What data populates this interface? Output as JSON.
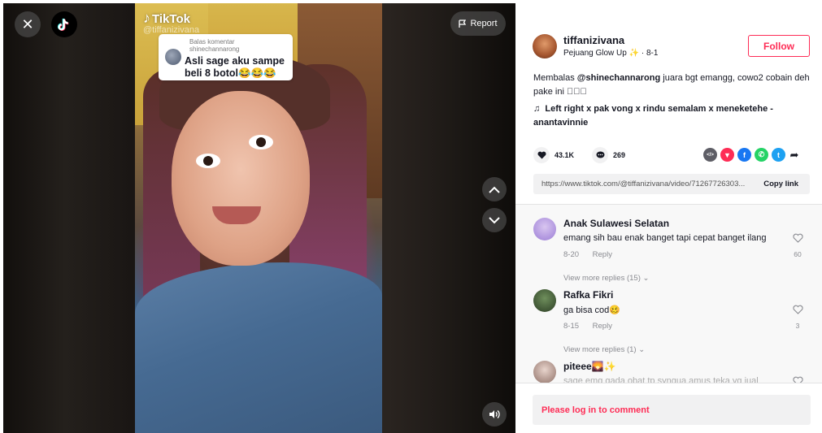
{
  "video": {
    "watermark": "TikTok",
    "watermark_handle": "@tiffanizivana",
    "report_label": "Report",
    "reply_bubble": {
      "label": "Balas komentar shinechannarong",
      "text": "Asli sage aku sampe beli 8 botol😂😂😂"
    },
    "icons": {
      "close": "close-icon",
      "logo": "tiktok-logo",
      "report": "flag-icon",
      "prev": "chevron-up-icon",
      "next": "chevron-down-icon",
      "sound": "speaker-icon"
    }
  },
  "author": {
    "username": "tiffanizivana",
    "subtitle_prefix": "Pejuang Glow Up",
    "subtitle_sparkle": "✨",
    "subtitle_date": "· 8-1",
    "follow_label": "Follow"
  },
  "post": {
    "desc_prefix": "Membalas ",
    "desc_mention": "@shinechannarong",
    "desc_rest": " juara bgt emangg, cowo2 cobain deh pake ini 𫝀𫝀𫝀",
    "music": "Left right x pak vong x rindu semalam x meneketehe - anantavinnie",
    "likes": "43.1K",
    "comments_count": "269",
    "link": "https://www.tiktok.com/@tiffanizivana/video/71267726303...",
    "copy_label": "Copy link",
    "share": [
      {
        "name": "embed-icon",
        "glyph": "</>",
        "color": "#5e5e66"
      },
      {
        "name": "send-icon",
        "glyph": "▼",
        "color": "#fe2c55"
      },
      {
        "name": "facebook-icon",
        "glyph": "f",
        "color": "#1877f2"
      },
      {
        "name": "whatsapp-icon",
        "glyph": "✆",
        "color": "#25d366"
      },
      {
        "name": "twitter-icon",
        "glyph": "t",
        "color": "#1da1f2"
      }
    ]
  },
  "comments": [
    {
      "name": "Anak Sulawesi Selatan",
      "text": "emang sih bau enak banget tapi cepat banget ilang",
      "date": "8-20",
      "reply": "Reply",
      "likes": "60",
      "view_more": "View more replies (15)"
    },
    {
      "name": "Rafka Fikri",
      "text": "ga bisa cod🥴",
      "date": "8-15",
      "reply": "Reply",
      "likes": "3",
      "view_more": "View more replies (1)"
    },
    {
      "name": "piteee🌄✨",
      "text": "sage emg gada obat tp syngua amus teka yg jual"
    }
  ],
  "login_prompt": "Please log in to comment",
  "colors": {
    "accent": "#fe2c55",
    "text": "#161823",
    "muted": "#8a8b91"
  }
}
